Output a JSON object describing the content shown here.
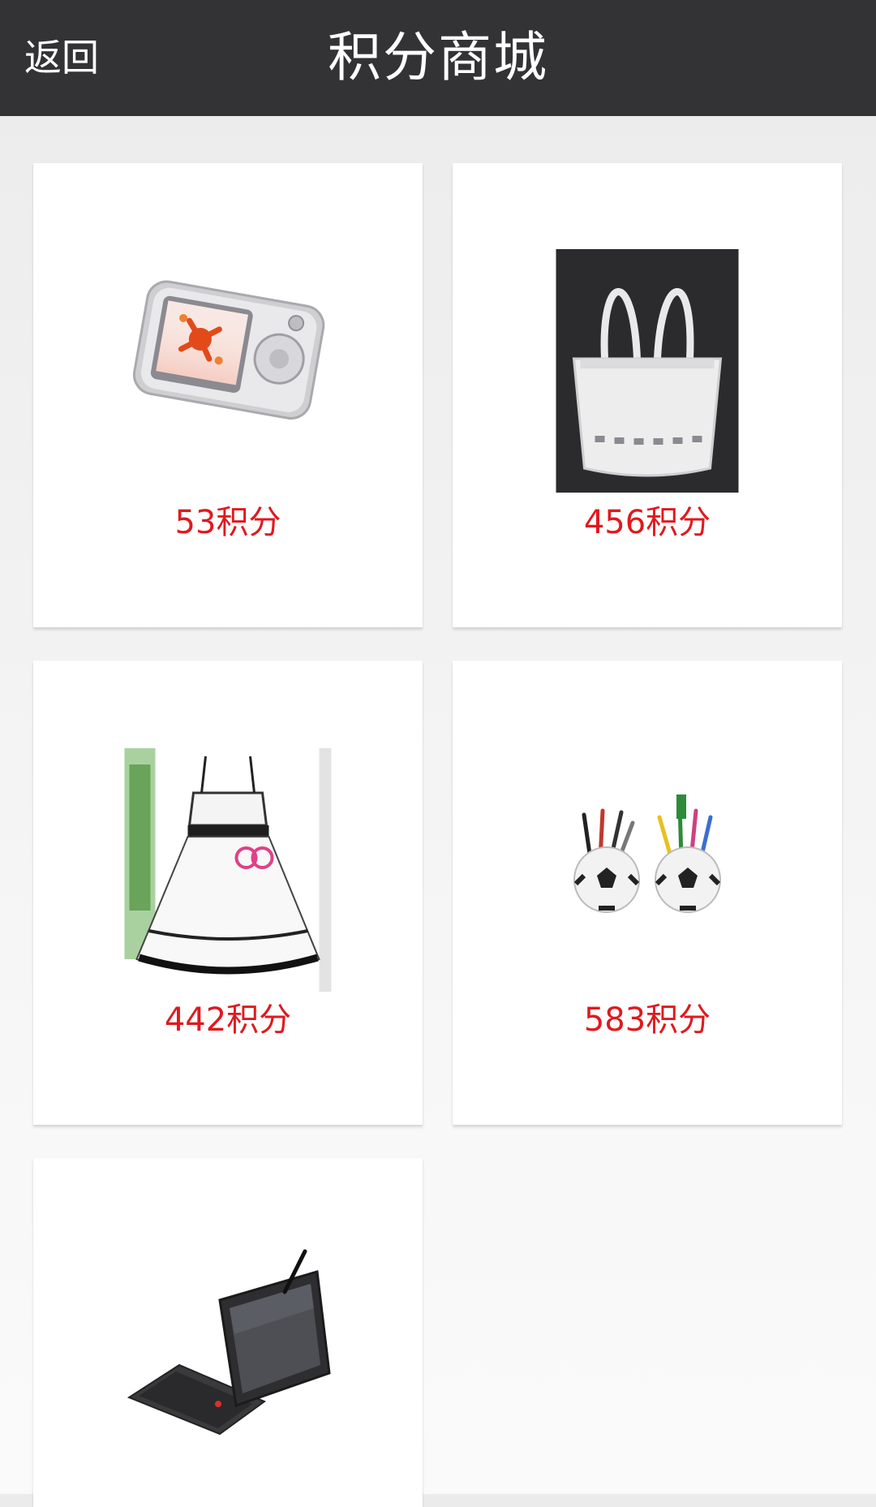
{
  "header": {
    "back_label": "返回",
    "title": "积分商城",
    "background_color": "#333336"
  },
  "products": [
    {
      "image_icon": "mp3-player-image",
      "price": "53积分"
    },
    {
      "image_icon": "white-handbag-image",
      "price": "456积分"
    },
    {
      "image_icon": "white-dress-image",
      "price": "442积分"
    },
    {
      "image_icon": "soccer-ball-pen-holder-image",
      "price": "583积分"
    },
    {
      "image_icon": "tablet-laptop-image",
      "price": ""
    }
  ],
  "colors": {
    "price": "#e0191e",
    "card": "#ffffff"
  }
}
